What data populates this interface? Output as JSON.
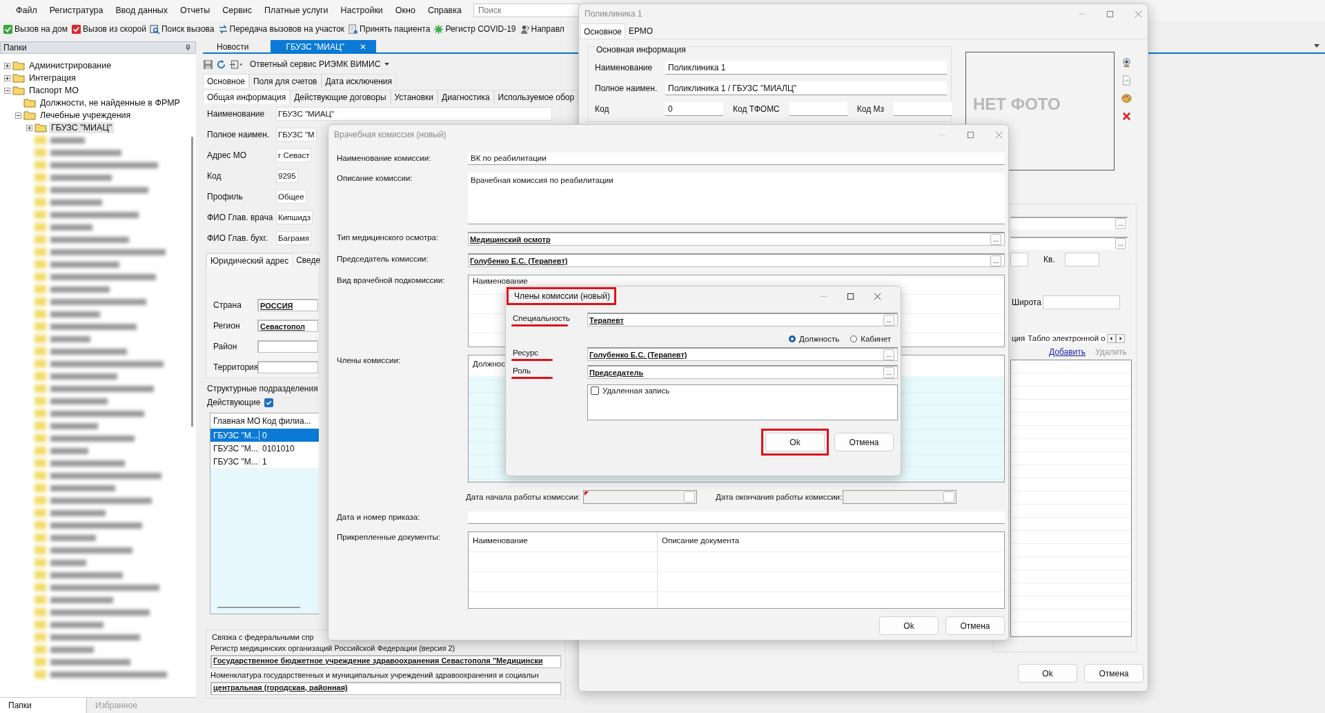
{
  "menu": [
    "Файл",
    "Регистратура",
    "Ввод данных",
    "Отчеты",
    "Сервис",
    "Платные услуги",
    "Настройки",
    "Окно",
    "Справка"
  ],
  "search": {
    "placeholder": "Поиск"
  },
  "toolbar": [
    {
      "label": "Вызов на дом",
      "kind": "home"
    },
    {
      "label": "Вызов из скорой",
      "kind": "ambulance"
    },
    {
      "label": "Поиск вызова",
      "kind": "find"
    },
    {
      "label": "Передача вызовов на участок",
      "kind": "transfer"
    },
    {
      "label": "Принять пациента",
      "kind": "accept"
    },
    {
      "label": "Регистр COVID-19",
      "kind": "virus"
    },
    {
      "label": "Направл",
      "kind": "referral"
    }
  ],
  "folders": {
    "title": "Папки",
    "tree": [
      {
        "label": "Администрирование",
        "expanded": false,
        "selected": false
      },
      {
        "label": "Интеграция",
        "expanded": false,
        "selected": false
      },
      {
        "label": "Паспорт МО",
        "expanded": true,
        "selected": false,
        "children": [
          {
            "label": "Должности, не найденные в ФРМР",
            "selected": false
          },
          {
            "label": "Лечебные учреждения",
            "expanded": true,
            "selected": false,
            "children": [
              {
                "label": "ГБУЗС \"МИАЦ\"",
                "expanded": false,
                "selected": true
              }
            ]
          }
        ]
      }
    ],
    "tabs": [
      {
        "label": "Папки",
        "selected": true
      },
      {
        "label": "Избранное",
        "selected": false
      }
    ]
  },
  "doc_tabs": [
    {
      "label": "Новости",
      "selected": false
    },
    {
      "label": "ГБУЗС \"МИАЦ\"",
      "selected": true,
      "close": "✕"
    }
  ],
  "doc_toolbar": {
    "service": "Ответный сервис РИЭМК ВИМИС"
  },
  "form_tabs": [
    {
      "label": "Основное",
      "selected": true
    },
    {
      "label": "Поля для счетов",
      "selected": false
    },
    {
      "label": "Дата исключения",
      "selected": false
    }
  ],
  "form_subtabs": [
    {
      "label": "Общая информация",
      "selected": true
    },
    {
      "label": "Действующие договоры",
      "selected": false
    },
    {
      "label": "Установки",
      "selected": false
    },
    {
      "label": "Диагностика",
      "selected": false
    },
    {
      "label": "Используемое обор",
      "selected": false
    }
  ],
  "fields": [
    {
      "label": "Наименование",
      "value": "ГБУЗС \"МИАЦ\""
    },
    {
      "label": "Полное наимен.",
      "value": "ГБУЗС \"М"
    },
    {
      "label": "Адрес МО",
      "value": "г Севаст"
    },
    {
      "label": "Код",
      "value": "9295"
    },
    {
      "label": "Профиль",
      "value": "Общее"
    },
    {
      "label": "ФИО Глав. врача",
      "value": "Кипшидз"
    },
    {
      "label": "ФИО Глав. бухг.",
      "value": "Баграмя"
    }
  ],
  "address": {
    "tabs": [
      {
        "label": "Юридический адрес",
        "selected": true
      },
      {
        "label": "Сведе",
        "selected": false
      }
    ],
    "fields": [
      {
        "label": "Страна",
        "value": "РОССИЯ"
      },
      {
        "label": "Регион",
        "value": "Севастопол"
      },
      {
        "label": "Район"
      },
      {
        "label": "Территория"
      }
    ]
  },
  "subdivisions": {
    "title": "Структурные подразделения",
    "active_label": "Действующие",
    "active_checked": true,
    "columns": [
      "Главная МО",
      "Код филиа..."
    ],
    "rows": [
      {
        "cells": [
          "ГБУЗС \"М...",
          "0"
        ],
        "selected": true
      },
      {
        "cells": [
          "ГБУЗС \"М...",
          "0101010"
        ],
        "selected": false
      },
      {
        "cells": [
          "ГБУЗС \"М...",
          "1"
        ],
        "selected": false
      }
    ]
  },
  "federal": {
    "title": "Связка с федеральными спр",
    "items": [
      {
        "label": "Регистр медицинских организаций Российской Федерации (версия 2)",
        "value": "Государственное бюджетное учреждение здравоохранения Севастополя \"Медицински"
      },
      {
        "label": "Номенклатура государственных и муниципальных учреждений здравоохранения и социальн",
        "value": "центральная (городская, районная)"
      }
    ]
  },
  "clinic_window": {
    "title": "Поликлиника 1",
    "tabs": [
      {
        "label": "Основное",
        "selected": true
      },
      {
        "label": "ЕРМО",
        "selected": false
      }
    ],
    "group": "Основная информация",
    "fields": [
      {
        "label": "Наименование",
        "value": "Поликлиника 1"
      },
      {
        "label": "Полное наимен.",
        "value": "Поликлиника 1 / ГБУЗС \"МИАЛЦ\""
      }
    ],
    "codes": [
      {
        "label": "Код",
        "value": "0"
      },
      {
        "label": "Код ТФОМС"
      },
      {
        "label": "Код Мз"
      }
    ],
    "photo": "НЕТ ФОТО",
    "apartment_label": "Кв.",
    "latitude_label": "Широта",
    "lower_tabs": [
      {
        "label": "ция",
        "selected": false
      },
      {
        "label": "Табло электронной о",
        "selected": true
      }
    ],
    "links": [
      {
        "label": "Добавить",
        "disabled": false
      },
      {
        "label": "Удалить",
        "disabled": true
      }
    ],
    "buttons": [
      "Ok",
      "Отмена"
    ]
  },
  "commission_window": {
    "title": "Врачебная комиссия (новый)",
    "name_label": "Наименование комиссии:",
    "name": "ВК по реабилитации",
    "description_label": "Описание комиссии:",
    "description": "Врачебная комиссия по реабилитации",
    "exam_type_label": "Тип медицинского осмотра:",
    "exam_type": "Медицинский осмотр",
    "chairman_label": "Председатель комиссии:",
    "chairman": "Голубенко Е.С. (Терапевт)",
    "subcommission_label": "Вид врачебной подкомиссии:",
    "subcommission_columns": [
      "Наименование"
    ],
    "members_label": "Члены комиссии:",
    "members_columns": [
      "Должнос"
    ],
    "start_label": "Дата начала работы комиссии:",
    "start_required": true,
    "end_label": "Дата окончания работы комиссии:",
    "order_label": "Дата и номер приказа:",
    "documents_label": "Прикрепленные документы:",
    "documents_columns": [
      "Наименование",
      "Описание документа"
    ],
    "buttons": [
      "Ok",
      "Отмена"
    ]
  },
  "member_dialog": {
    "title": "Члены комиссии (новый)",
    "title_highlighted": true,
    "fields": [
      {
        "label": "Специальность",
        "value": "Терапевт",
        "highlighted": true
      },
      {
        "label": "Ресурс",
        "value": "Голубенко Е.С. (Терапевт)",
        "highlighted": true
      },
      {
        "label": "Роль",
        "value": "Председатель",
        "highlighted": true
      }
    ],
    "radios": [
      {
        "label": "Должность",
        "selected": true
      },
      {
        "label": "Кабинет",
        "selected": false
      }
    ],
    "deleted_label": "Удаленная запись",
    "deleted_checked": false,
    "buttons": [
      {
        "label": "Ok",
        "highlighted": true
      },
      {
        "label": "Отмена",
        "highlighted": false
      }
    ]
  }
}
